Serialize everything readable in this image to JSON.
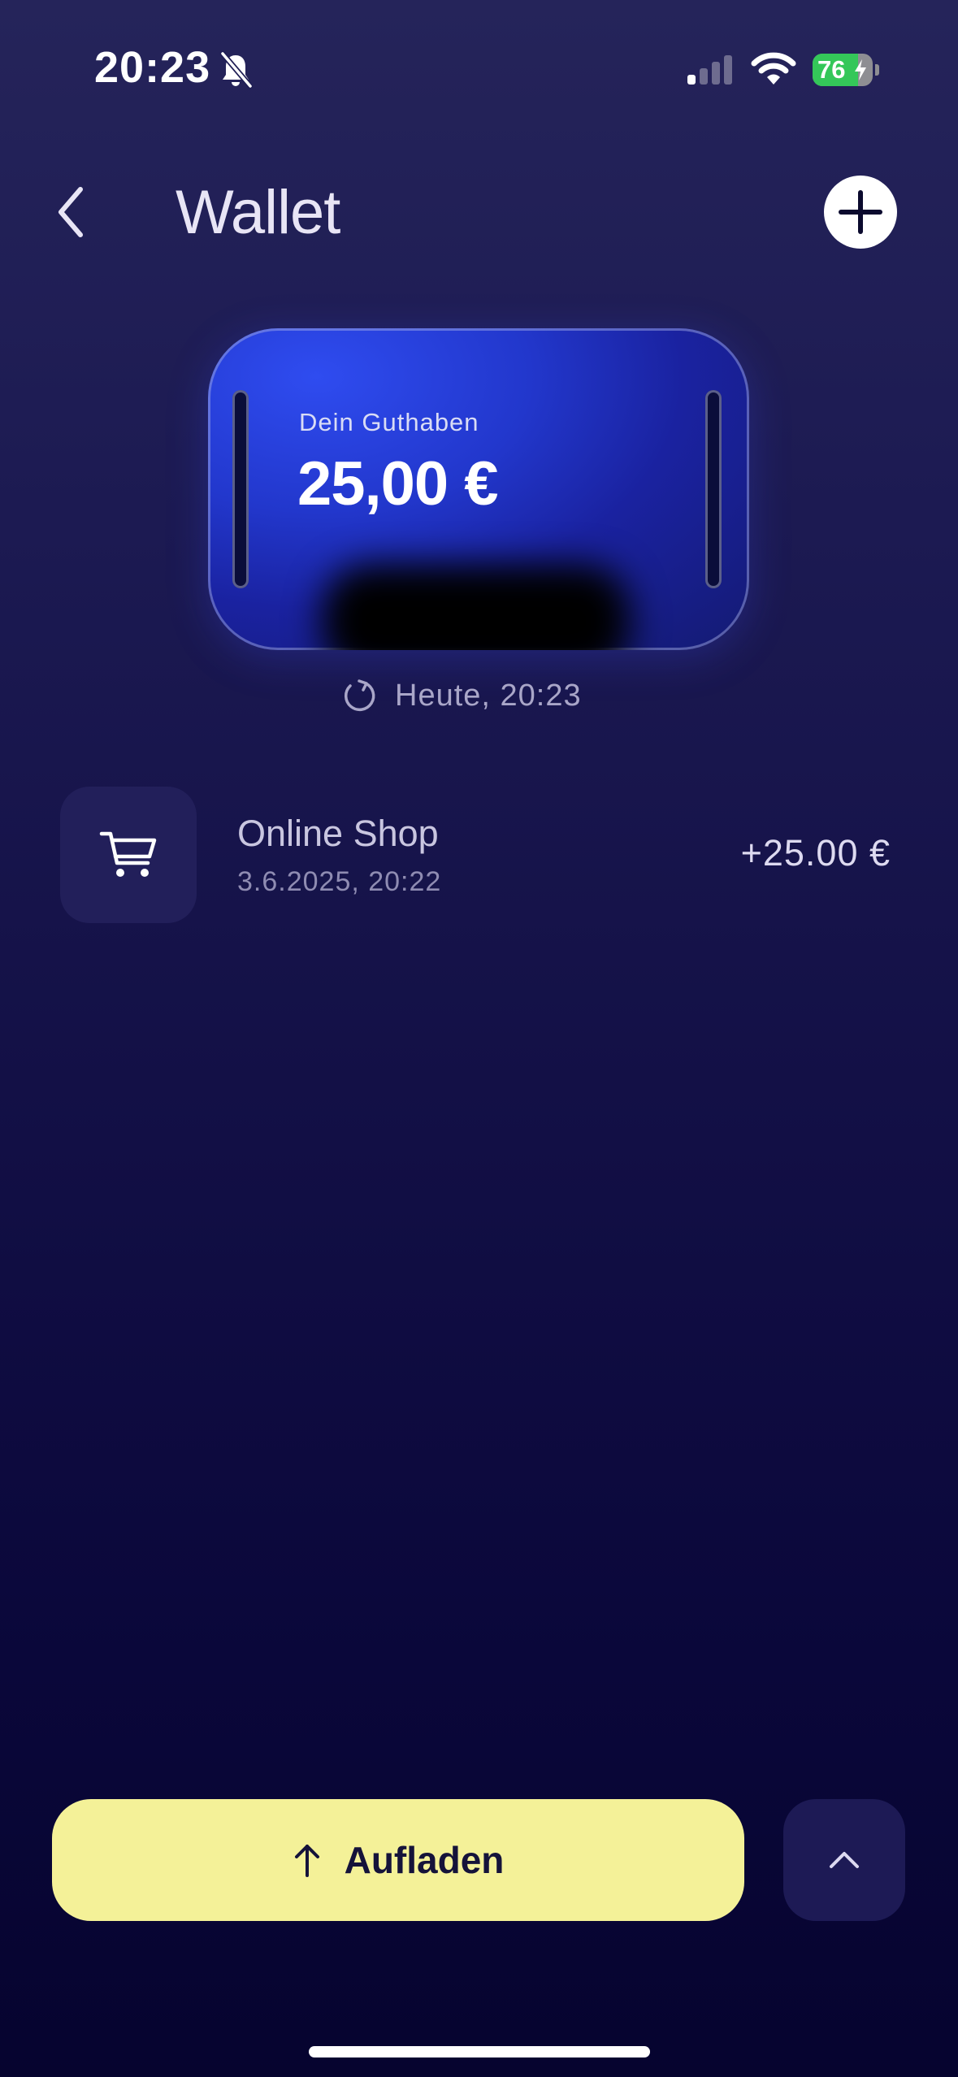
{
  "status_bar": {
    "time": "20:23",
    "battery_percent": "76",
    "battery_level": 0.76
  },
  "header": {
    "title": "Wallet"
  },
  "card": {
    "label": "Dein Guthaben",
    "amount": "25,00 €"
  },
  "updated": {
    "text": "Heute, 20:23"
  },
  "transactions": [
    {
      "title": "Online Shop",
      "date": "3.6.2025, 20:22",
      "amount": "+25.00 €",
      "icon": "cart-icon"
    }
  ],
  "actions": {
    "topup_label": "Aufladen"
  },
  "colors": {
    "accent_yellow": "#f4f198",
    "card_blue": "#2237cc",
    "battery_green": "#34c759"
  }
}
